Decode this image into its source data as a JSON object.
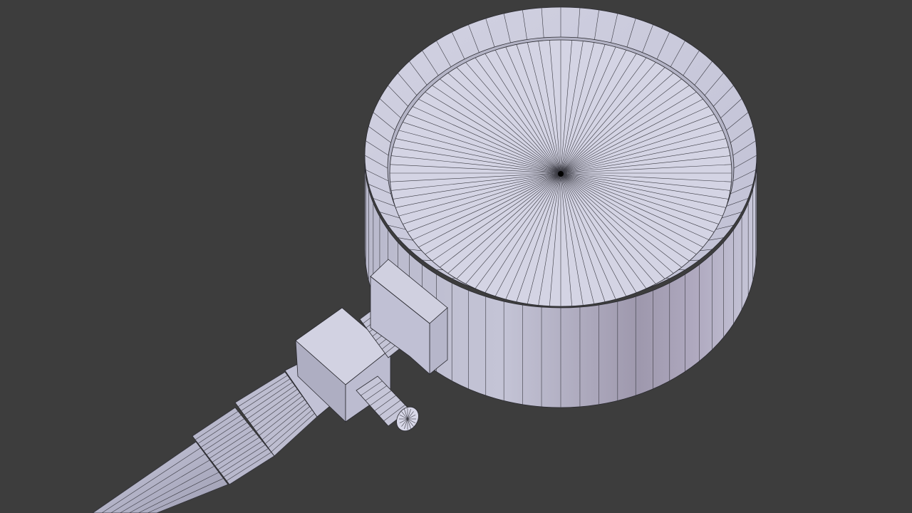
{
  "viewport": {
    "background": "#3d3d3d",
    "mesh_color": "#c8c8dc",
    "wire_color": "#2a2a30",
    "shading": "solid-with-wireframe"
  },
  "model": {
    "parts": [
      "gauge-housing",
      "gauge-face",
      "mounting-bracket",
      "tee-fitting",
      "side-nozzle",
      "pipe-stem"
    ],
    "gauge_face_segments": 96,
    "housing_segments": 64
  }
}
